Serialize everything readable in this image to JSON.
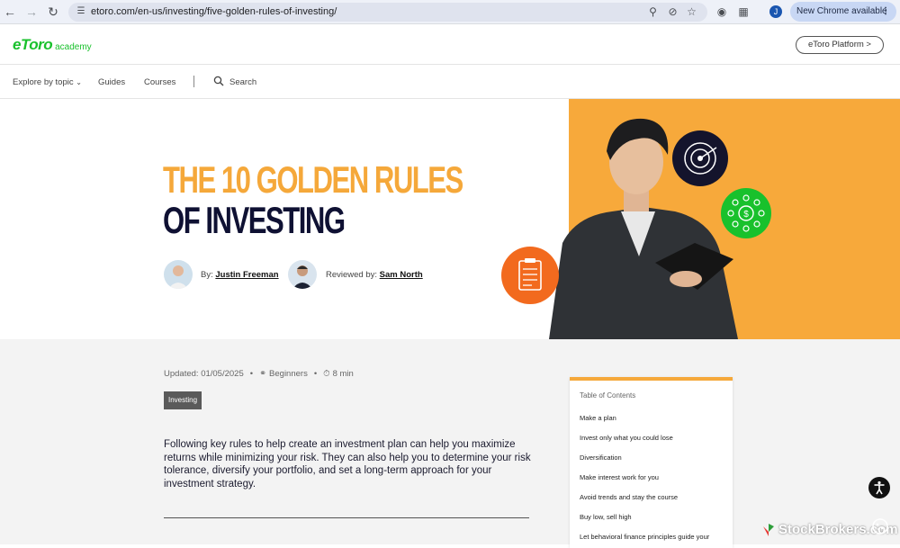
{
  "browser": {
    "url": "etoro.com/en-us/investing/five-golden-rules-of-investing/",
    "profile_initial": "J",
    "update_label": "New Chrome available"
  },
  "header": {
    "logo_brand": "eToro",
    "logo_sub": "academy",
    "platform_button": "eToro Platform >"
  },
  "nav": {
    "explore": "Explore by topic",
    "guides": "Guides",
    "courses": "Courses",
    "search": "Search"
  },
  "hero": {
    "title_line1": "THE 10 GOLDEN RULES",
    "title_line2": "OF INVESTING",
    "by_label": "By:",
    "author": "Justin Freeman",
    "reviewed_label": "Reviewed by:",
    "reviewer": "Sam North"
  },
  "article": {
    "updated": "Updated: 01/05/2025",
    "level": "Beginners",
    "read_time": "8 min",
    "tag": "Investing",
    "intro": "Following key rules to help create an investment plan can help you maximize returns while minimizing your risk. They can also help you to determine your risk tolerance, diversify your portfolio, and set a long-term approach for your investment strategy."
  },
  "toc": {
    "title": "Table of Contents",
    "items": [
      "Make a plan",
      "Invest only what you could lose",
      "Diversification",
      "Make interest work for you",
      "Avoid trends and stay the course",
      "Buy low, sell high",
      "Let behavioral finance principles guide your"
    ]
  },
  "watermark": "StockBrokers.com",
  "colors": {
    "accent_orange": "#f5a83a",
    "brand_green": "#19c12c",
    "navy": "#0f1133"
  }
}
